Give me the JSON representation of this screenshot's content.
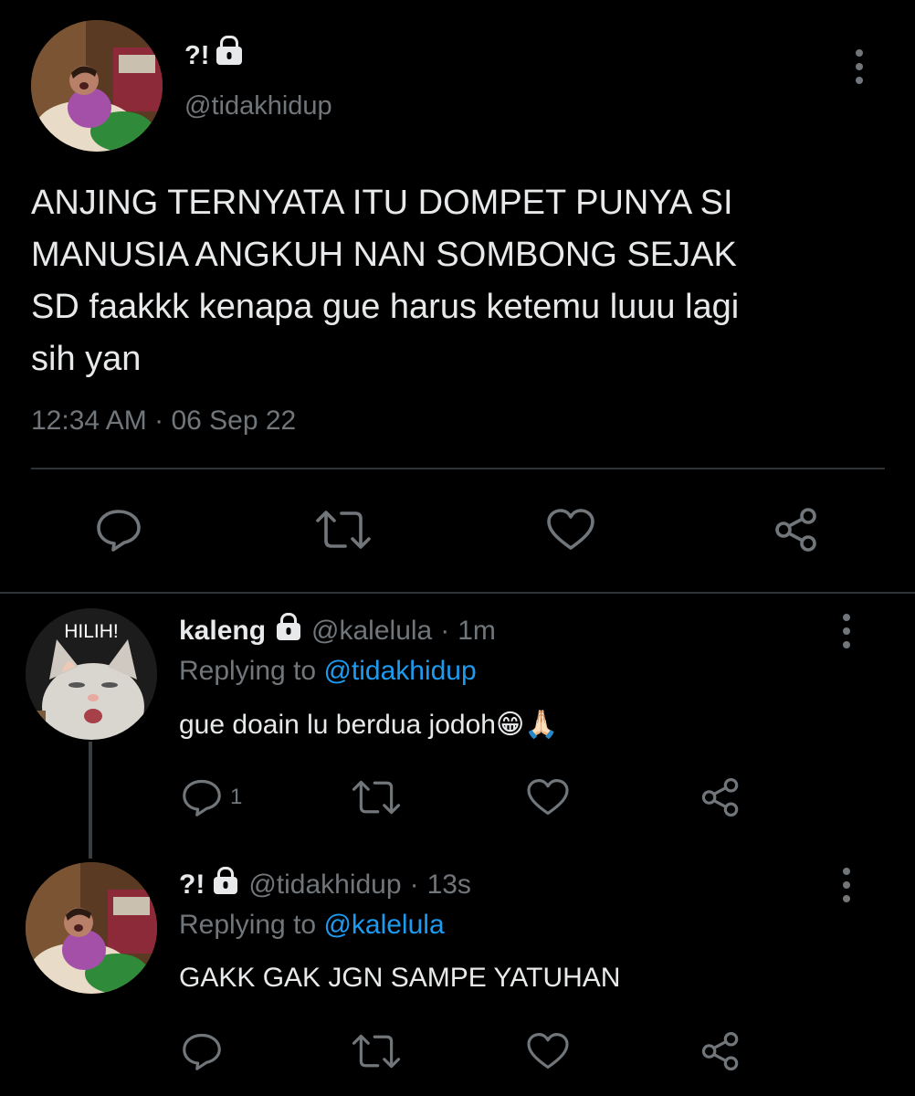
{
  "main_tweet": {
    "display_name": "?!",
    "handle": "@tidakhidup",
    "text_lines": [
      "ANJING TERNYATA ITU DOMPET PUNYA SI",
      "MANUSIA ANGKUH NAN SOMBONG SEJAK",
      "SD faakkk kenapa gue harus ketemu luuu lagi",
      "sih yan"
    ],
    "time": "12:34 AM",
    "separator": "·",
    "date": "06 Sep 22"
  },
  "reply1": {
    "avatar_caption": "HILIH!",
    "display_name": "kaleng",
    "handle": "@kalelula",
    "dot": "·",
    "age": "1m",
    "replying_prefix": "Replying to",
    "replying_to": "@tidakhidup",
    "text": "gue doain lu berdua jodoh😁🙏🏻",
    "reply_count": "1"
  },
  "reply2": {
    "display_name": "?!",
    "handle": "@tidakhidup",
    "dot": "·",
    "age": "13s",
    "replying_prefix": "Replying to",
    "replying_to": "@kalelula",
    "text": "GAKK GAK JGN SAMPE YATUHAN"
  },
  "icons": {
    "reply": "reply-icon",
    "retweet": "retweet-icon",
    "like": "heart-icon",
    "share": "share-icon",
    "more": "more-icon",
    "lock": "lock-icon"
  },
  "colors": {
    "background": "#000000",
    "text": "#e7e9ea",
    "muted": "#71767b",
    "link": "#1d9bf0",
    "divider": "#2f3336"
  }
}
